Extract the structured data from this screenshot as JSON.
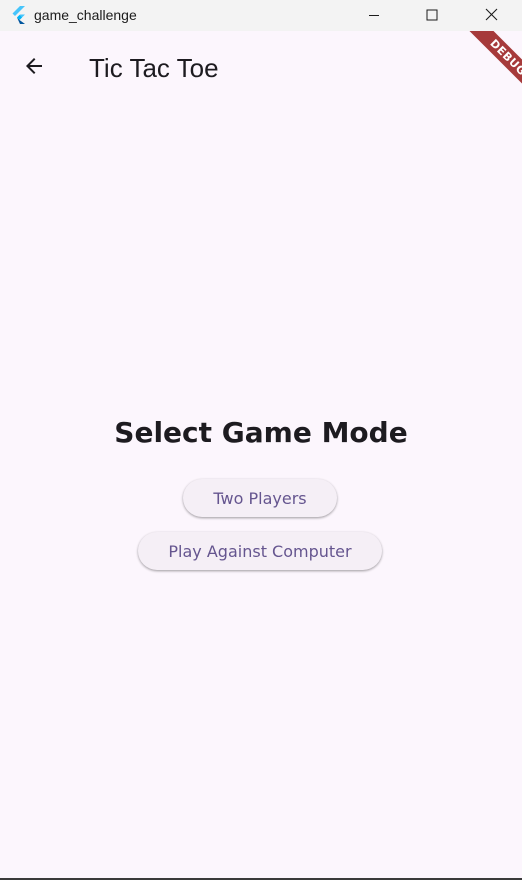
{
  "window": {
    "title": "game_challenge",
    "controls": {
      "minimize_icon": "minimize-icon",
      "maximize_icon": "maximize-icon",
      "close_icon": "close-icon"
    }
  },
  "appbar": {
    "back_icon": "arrow-back-icon",
    "title": "Tic Tac Toe"
  },
  "debug_banner": {
    "label": "DEBUG",
    "color": "#a63a3b"
  },
  "main": {
    "heading": "Select Game Mode",
    "buttons": [
      {
        "label": "Two Players"
      },
      {
        "label": "Play Against Computer"
      }
    ]
  },
  "colors": {
    "background": "#fcf6fd",
    "button_text": "#65558f",
    "button_bg": "#f5eff6",
    "text": "#1d1b20"
  }
}
